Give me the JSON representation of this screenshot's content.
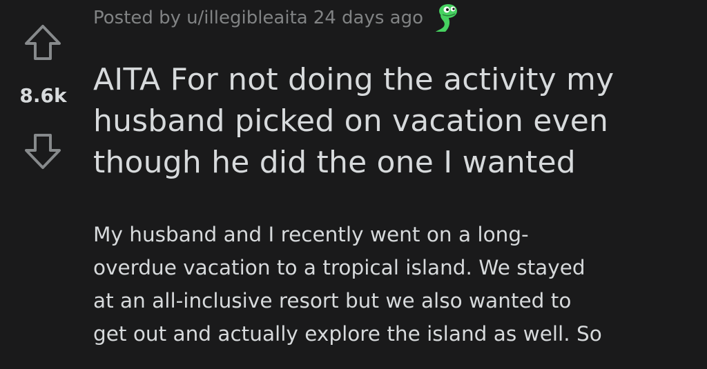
{
  "post": {
    "posted_by_prefix": "Posted by",
    "author": "u/illegibleaita",
    "age": "24 days ago",
    "score": "8.6k",
    "title": "AITA For not doing the activity my husband picked on vacation even though he did the one I wanted",
    "body_lines": [
      "My husband and I recently went on a long-",
      "overdue vacation to a tropical island. We stayed",
      "at an all-inclusive resort but we also wanted to",
      "get out and actually explore the island as well. So"
    ]
  },
  "icons": {
    "upvote": "upvote-arrow-icon",
    "downvote": "downvote-arrow-icon",
    "award": "snoo-dino-icon"
  },
  "colors": {
    "background": "#1a1a1b",
    "text": "#d7dadc",
    "meta": "#818384",
    "icon_green": "#46d160"
  }
}
